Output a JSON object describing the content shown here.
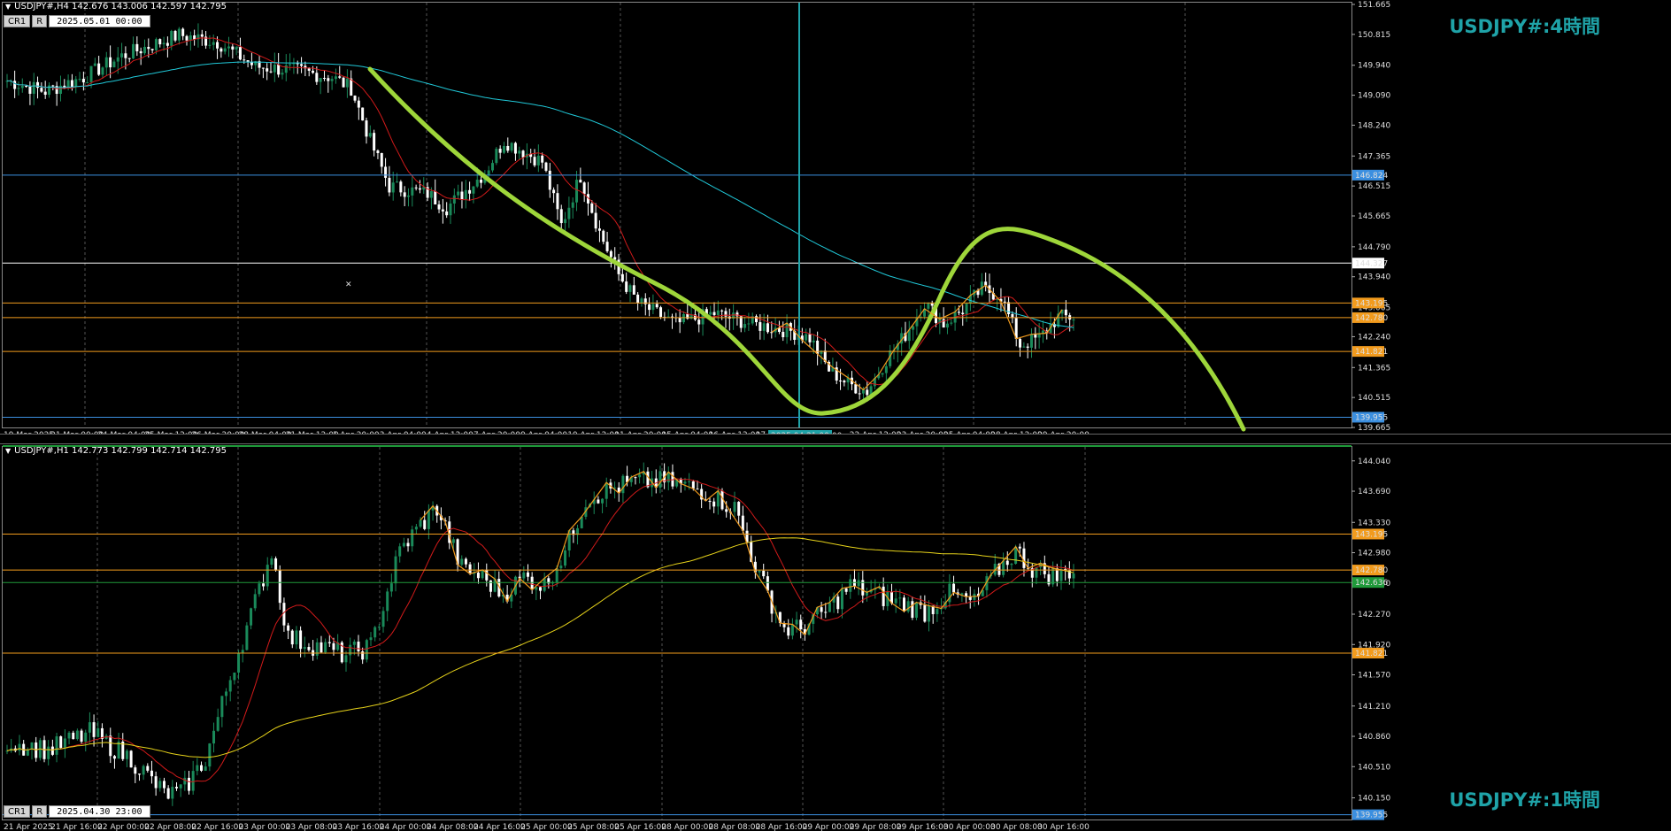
{
  "colors": {
    "bull": "#1a8a5a",
    "bear": "#ffffff",
    "bg": "#000000",
    "grid": "#555555",
    "orange": "#f29b1d",
    "teal": "#1fa3a8"
  },
  "top": {
    "header": "USDJPY#,H4  142.676 143.006 142.597 142.795",
    "cr": "CR1",
    "r": "R",
    "datetime": "2025.05.01 00:00",
    "title": "USDJPY#:4時間",
    "cursor_label": "2025.04.21 00:00",
    "price_ticks": [
      "151.665",
      "150.815",
      "149.940",
      "149.090",
      "148.240",
      "147.365",
      "146.515",
      "145.665",
      "144.790",
      "143.940",
      "143.065",
      "142.240",
      "141.365",
      "140.515",
      "139.665"
    ],
    "time_labels": [
      "19 Mar 2025",
      "21 Mar 00:00",
      "24 Mar 04:00",
      "25 Mar 12:00",
      "26 Mar 20:00",
      "28 Mar 04:00",
      "31 Mar 12:00",
      "1 Apr 20:00",
      "3 Apr 04:00",
      "4 Apr 12:00",
      "7 Apr 20:00",
      "9 Apr 04:00",
      "10 Apr 12:00",
      "11 Apr 20:00",
      "15 Apr 04:00",
      "16 Apr 12:00",
      "17 Apr 20:00",
      "",
      "22 Apr 12:00",
      "23 Apr 20:00",
      "25 Apr 04:00",
      "28 Apr 12:00",
      "29 Apr 20:00"
    ],
    "levels": [
      {
        "price": "146.824",
        "color": "#3b8fe0",
        "label_bg": "#3b8fe0"
      },
      {
        "price": "144.327",
        "color": "#ffffff",
        "label_bg": "#ffffff"
      },
      {
        "price": "143.195",
        "color": "#f29b1d",
        "label_bg": "#f29b1d"
      },
      {
        "price": "142.780",
        "color": "#f29b1d",
        "label_bg": "#f29b1d"
      },
      {
        "price": "141.821",
        "color": "#f29b1d",
        "label_bg": "#f29b1d"
      },
      {
        "price": "139.955",
        "color": "#3b8fe0",
        "label_bg": "#3b8fe0"
      }
    ]
  },
  "bottom": {
    "header": "USDJPY#,H1  142.773 142.799 142.714 142.795",
    "cr": "CR1",
    "r": "R",
    "datetime": "2025.04.30 23:00",
    "title": "USDJPY#:1時間",
    "price_ticks": [
      "144.040",
      "143.690",
      "143.330",
      "142.980",
      "142.630",
      "142.270",
      "141.920",
      "141.570",
      "141.210",
      "140.860",
      "140.510",
      "140.150"
    ],
    "time_labels": [
      "21 Apr 2025",
      "21 Apr 16:00",
      "22 Apr 00:00",
      "22 Apr 08:00",
      "22 Apr 16:00",
      "23 Apr 00:00",
      "23 Apr 08:00",
      "23 Apr 16:00",
      "24 Apr 00:00",
      "24 Apr 08:00",
      "24 Apr 16:00",
      "25 Apr 00:00",
      "25 Apr 08:00",
      "25 Apr 16:00",
      "28 Apr 00:00",
      "28 Apr 08:00",
      "28 Apr 16:00",
      "29 Apr 00:00",
      "29 Apr 08:00",
      "29 Apr 16:00",
      "30 Apr 00:00",
      "30 Apr 08:00",
      "30 Apr 16:00"
    ],
    "levels": [
      {
        "price": "143.195",
        "color": "#f29b1d",
        "label_bg": "#f29b1d"
      },
      {
        "price": "142.780",
        "color": "#f29b1d",
        "label_bg": "#f29b1d"
      },
      {
        "price": "142.636",
        "color": "#1f9a3a",
        "label_bg": "#1f9a3a"
      },
      {
        "price": "141.821",
        "color": "#f29b1d",
        "label_bg": "#f29b1d"
      },
      {
        "price": "139.955",
        "color": "#3b8fe0",
        "label_bg": "#3b8fe0"
      }
    ]
  }
}
